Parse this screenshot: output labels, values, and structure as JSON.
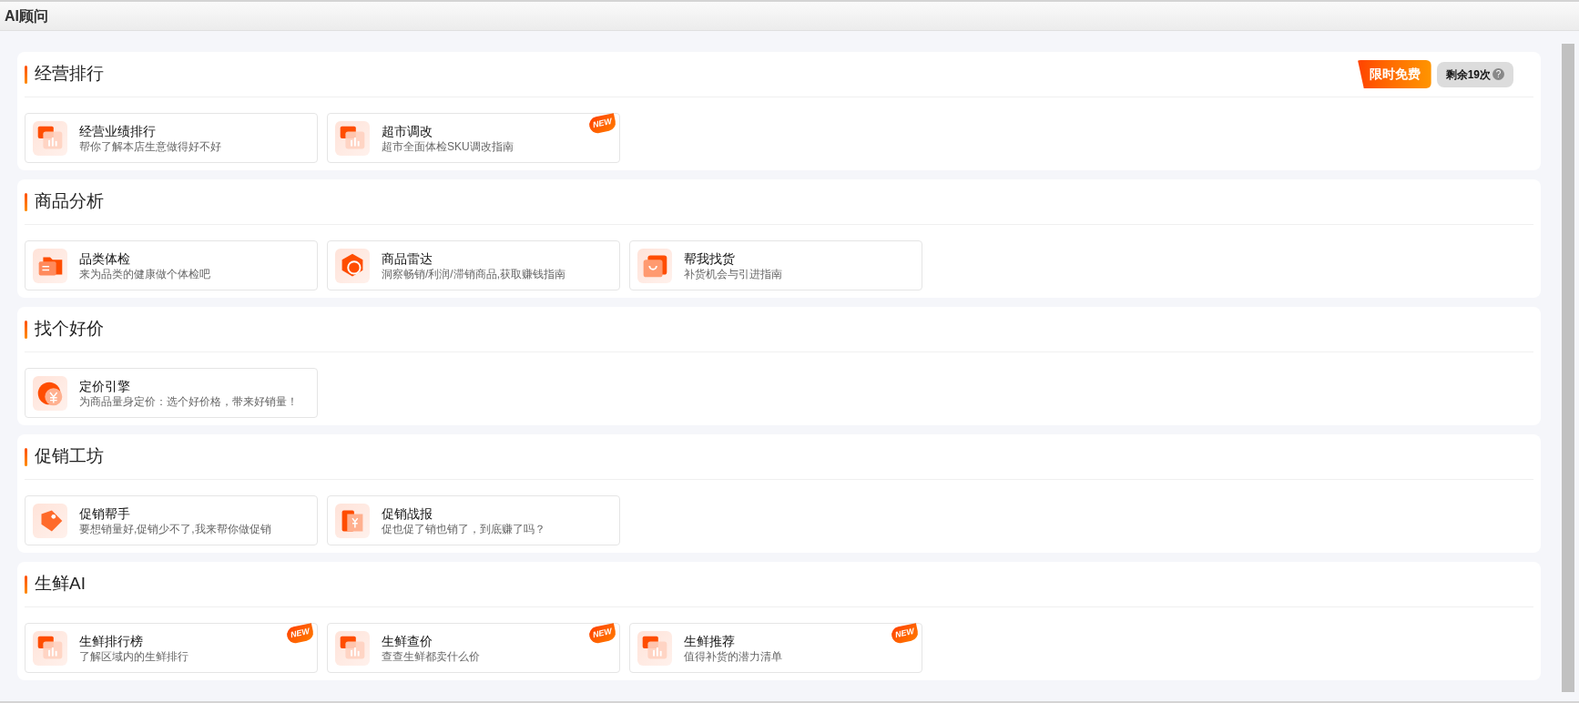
{
  "window": {
    "title": "AI顾问"
  },
  "sections": [
    {
      "title": "经营排行",
      "badges": {
        "promo": "限时免费",
        "remaining": "剩余19次",
        "help_icon": "?"
      },
      "tiles": [
        {
          "kind": "bars",
          "title": "经营业绩排行",
          "subtitle": "帮你了解本店生意做得好不好"
        },
        {
          "kind": "bars",
          "title": "超市调改",
          "subtitle": "超市全面体检SKU调改指南",
          "badge": "NEW"
        }
      ]
    },
    {
      "title": "商品分析",
      "tiles": [
        {
          "kind": "folder",
          "title": "品类体检",
          "subtitle": "来为品类的健康做个体检吧"
        },
        {
          "kind": "radar",
          "title": "商品雷达",
          "subtitle": "洞察畅销/利润/滞销商品,获取赚钱指南"
        },
        {
          "kind": "bag",
          "title": "帮我找货",
          "subtitle": "补货机会与引进指南"
        }
      ]
    },
    {
      "title": "找个好价",
      "tiles": [
        {
          "kind": "coin",
          "title": "定价引擎",
          "subtitle": "为商品量身定价：选个好价格，带来好销量！"
        }
      ]
    },
    {
      "title": "促销工坊",
      "tiles": [
        {
          "kind": "tag",
          "title": "促销帮手",
          "subtitle": "要想销量好,促销少不了,我来帮你做促销"
        },
        {
          "kind": "report",
          "title": "促销战报",
          "subtitle": "促也促了销也销了，到底赚了吗？"
        }
      ]
    },
    {
      "title": "生鲜AI",
      "tiles": [
        {
          "kind": "bars",
          "title": "生鲜排行榜",
          "subtitle": "了解区域内的生鲜排行",
          "badge": "NEW"
        },
        {
          "kind": "bars",
          "title": "生鲜查价",
          "subtitle": "查查生鲜都卖什么价",
          "badge": "NEW"
        },
        {
          "kind": "bars",
          "title": "生鲜推荐",
          "subtitle": "值得补货的潜力清单",
          "badge": "NEW"
        }
      ]
    }
  ]
}
